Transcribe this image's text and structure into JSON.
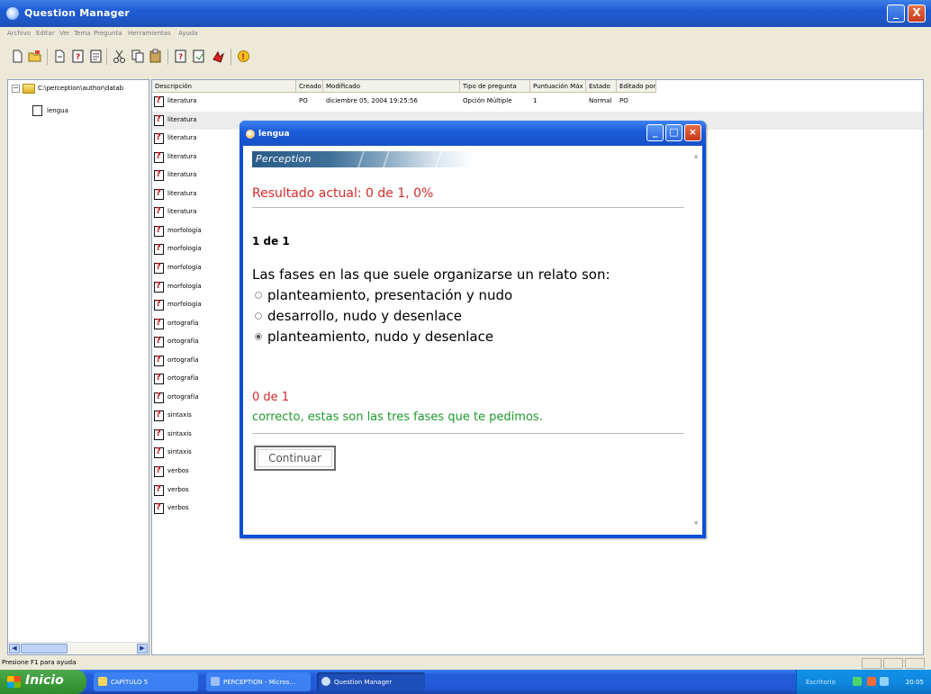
{
  "window": {
    "title": "Question Manager",
    "controls": {
      "minimize": "_",
      "maximize": "□",
      "close": "X"
    }
  },
  "menu": {
    "items": [
      "Archivo",
      "Editar",
      "Ver",
      "Tema",
      "Pregunta",
      "Herramientas",
      "Ayuda"
    ]
  },
  "toolbar": {
    "buttons": [
      "new-icon",
      "open-icon",
      "new-folder-icon",
      "properties-icon",
      "save-icon",
      "cut-icon",
      "copy-icon",
      "paste-icon",
      "import-icon",
      "export-icon",
      "run-icon",
      "help-icon"
    ]
  },
  "tree": {
    "root_label": "C:\\perception\\author\\datab",
    "child_label": "lengua"
  },
  "list": {
    "columns": [
      "Descripción",
      "Creado por",
      "Modificado",
      "Tipo de pregunta",
      "Puntuación Máx",
      "Estado",
      "Editado por"
    ],
    "rows": [
      {
        "description": "literatura",
        "created_by": "PO",
        "modified": "diciembre 05, 2004 19:25:56",
        "type": "Opción Múltiple",
        "max_score": "1",
        "status": "Normal",
        "edited_by": "PO"
      },
      {
        "description": "literatura"
      },
      {
        "description": "literatura"
      },
      {
        "description": "literatura"
      },
      {
        "description": "literatura"
      },
      {
        "description": "literatura"
      },
      {
        "description": "literatura"
      },
      {
        "description": "morfología"
      },
      {
        "description": "morfología"
      },
      {
        "description": "morfología"
      },
      {
        "description": "morfología"
      },
      {
        "description": "morfología"
      },
      {
        "description": "ortografía"
      },
      {
        "description": "ortografía"
      },
      {
        "description": "ortografía"
      },
      {
        "description": "ortografía"
      },
      {
        "description": "ortografía"
      },
      {
        "description": "sintaxis"
      },
      {
        "description": "sintaxis"
      },
      {
        "description": "sintaxis"
      },
      {
        "description": "verbos"
      },
      {
        "description": "verbos"
      },
      {
        "description": "verbos"
      }
    ]
  },
  "status_bar": {
    "text": "Presione F1 para ayuda"
  },
  "taskbar": {
    "start_label": "Inicio",
    "items": [
      "CAPÍTULO 5",
      "PERCEPTION - Micros...",
      "Question Manager"
    ],
    "tray_text": "Escritorio",
    "clock": "20:05"
  },
  "dialog": {
    "title": "lengua",
    "banner_text": "Perception",
    "result_text": "Resultado actual: 0 de 1, 0%",
    "counter": "1 de 1",
    "question": "Las fases en las que suele organizarse un relato son:",
    "options": [
      {
        "text": "planteamiento, presentación y nudo",
        "selected": false
      },
      {
        "text": "desarrollo, nudo y desenlace",
        "selected": false
      },
      {
        "text": "planteamiento, nudo y desenlace",
        "selected": true
      }
    ],
    "score": "0 de 1",
    "feedback": "correcto, estas son las tres fases que te pedimos.",
    "continue_label": "Continuar"
  },
  "colors": {
    "titlebar_blue": "#1d5ad4",
    "result_red": "#d62a2a",
    "feedback_green": "#1e9a2c",
    "start_green": "#3c9a39"
  }
}
